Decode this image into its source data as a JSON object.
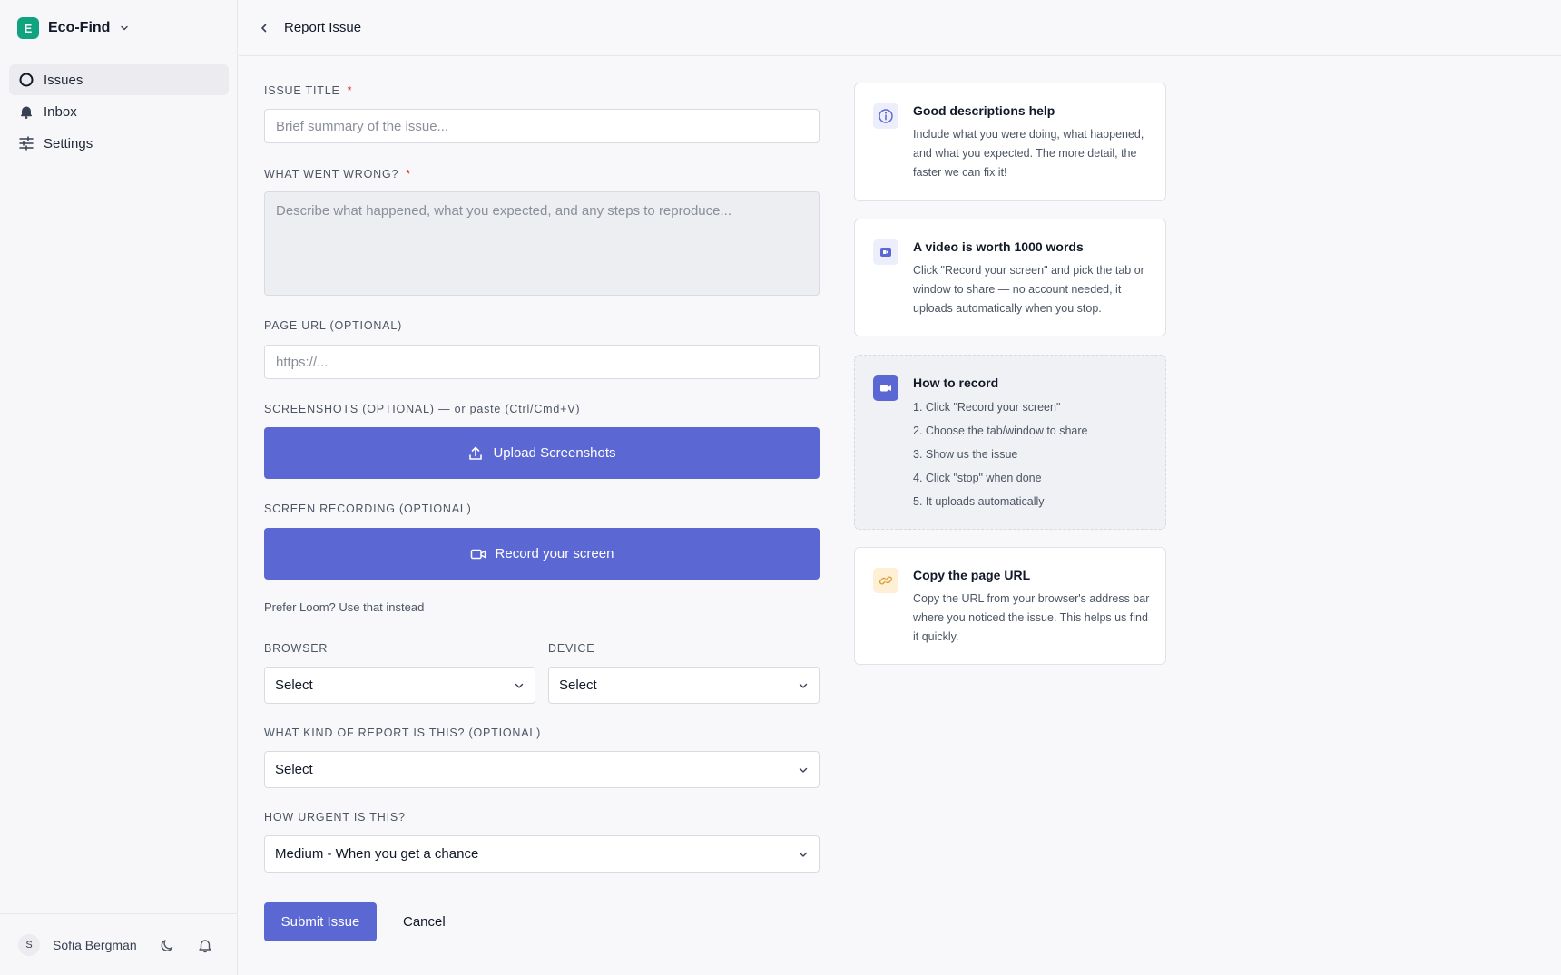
{
  "workspace": {
    "initial": "E",
    "name": "Eco-Find"
  },
  "nav": [
    {
      "label": "Issues",
      "icon": "circle-icon",
      "active": true
    },
    {
      "label": "Inbox",
      "icon": "bell-icon",
      "active": false
    },
    {
      "label": "Settings",
      "icon": "sliders-icon",
      "active": false
    }
  ],
  "user": {
    "initial": "S",
    "name": "Sofia Bergman"
  },
  "header": {
    "title": "Report Issue"
  },
  "form": {
    "title_label": "ISSUE TITLE",
    "required_mark": "*",
    "title_placeholder": "Brief summary of the issue...",
    "wrong_label": "WHAT WENT WRONG?",
    "wrong_placeholder": "Describe what happened, what you expected, and any steps to reproduce...",
    "url_label": "PAGE URL (OPTIONAL)",
    "url_placeholder": "https://...",
    "screenshots_label": "SCREENSHOTS (OPTIONAL) — or paste (Ctrl/Cmd+V)",
    "upload_label": "Upload Screenshots",
    "recording_label": "SCREEN RECORDING (OPTIONAL)",
    "record_label": "Record your screen",
    "loom_text": "Prefer Loom? Use that instead",
    "browser_label": "BROWSER",
    "browser_value": "Select",
    "device_label": "DEVICE",
    "device_value": "Select",
    "kind_label": "WHAT KIND OF REPORT IS THIS? (OPTIONAL)",
    "kind_value": "Select",
    "urgency_label": "HOW URGENT IS THIS?",
    "urgency_value": "Medium - When you get a chance",
    "submit_label": "Submit Issue",
    "cancel_label": "Cancel"
  },
  "tips": {
    "descriptions": {
      "title": "Good descriptions help",
      "body": "Include what you were doing, what happened, and what you expected. The more detail, the faster we can fix it!"
    },
    "video": {
      "title": "A video is worth 1000 words",
      "body": "Click \"Record your screen\" and pick the tab or window to share — no account needed, it uploads automatically when you stop."
    },
    "howto": {
      "title": "How to record",
      "steps": [
        "1. Click \"Record your screen\"",
        "2. Choose the tab/window to share",
        "3. Show us the issue",
        "4. Click \"stop\" when done",
        "5. It uploads automatically"
      ]
    },
    "copyurl": {
      "title": "Copy the page URL",
      "body": "Copy the URL from your browser's address bar where you noticed the issue. This helps us find it quickly."
    }
  },
  "colors": {
    "accent": "#5b67d3",
    "brand": "#10a37f",
    "required": "#dc2626",
    "link_icon_bg": "#fdf0d5"
  }
}
